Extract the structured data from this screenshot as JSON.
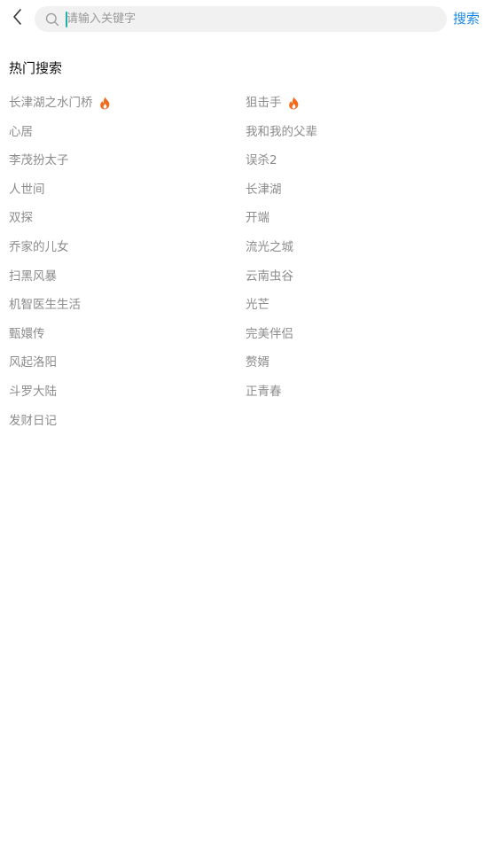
{
  "header": {
    "search": {
      "placeholder": "请输入关键字",
      "value": ""
    },
    "search_button_label": "搜索"
  },
  "hot_search": {
    "title": "热门搜索",
    "accent_color": "#f26b1d",
    "items": [
      {
        "label": "长津湖之水门桥",
        "hot": true
      },
      {
        "label": "狙击手",
        "hot": true
      },
      {
        "label": "心居",
        "hot": false
      },
      {
        "label": "我和我的父辈",
        "hot": false
      },
      {
        "label": "李茂扮太子",
        "hot": false
      },
      {
        "label": "误杀2",
        "hot": false
      },
      {
        "label": "人世间",
        "hot": false
      },
      {
        "label": "长津湖",
        "hot": false
      },
      {
        "label": "双探",
        "hot": false
      },
      {
        "label": "开端",
        "hot": false
      },
      {
        "label": "乔家的儿女",
        "hot": false
      },
      {
        "label": "流光之城",
        "hot": false
      },
      {
        "label": "扫黑风暴",
        "hot": false
      },
      {
        "label": "云南虫谷",
        "hot": false
      },
      {
        "label": "机智医生生活",
        "hot": false
      },
      {
        "label": "光芒",
        "hot": false
      },
      {
        "label": "甄嬛传",
        "hot": false
      },
      {
        "label": "完美伴侣",
        "hot": false
      },
      {
        "label": "风起洛阳",
        "hot": false
      },
      {
        "label": "赘婿",
        "hot": false
      },
      {
        "label": "斗罗大陆",
        "hot": false
      },
      {
        "label": "正青春",
        "hot": false
      },
      {
        "label": "发财日记",
        "hot": false
      }
    ]
  }
}
